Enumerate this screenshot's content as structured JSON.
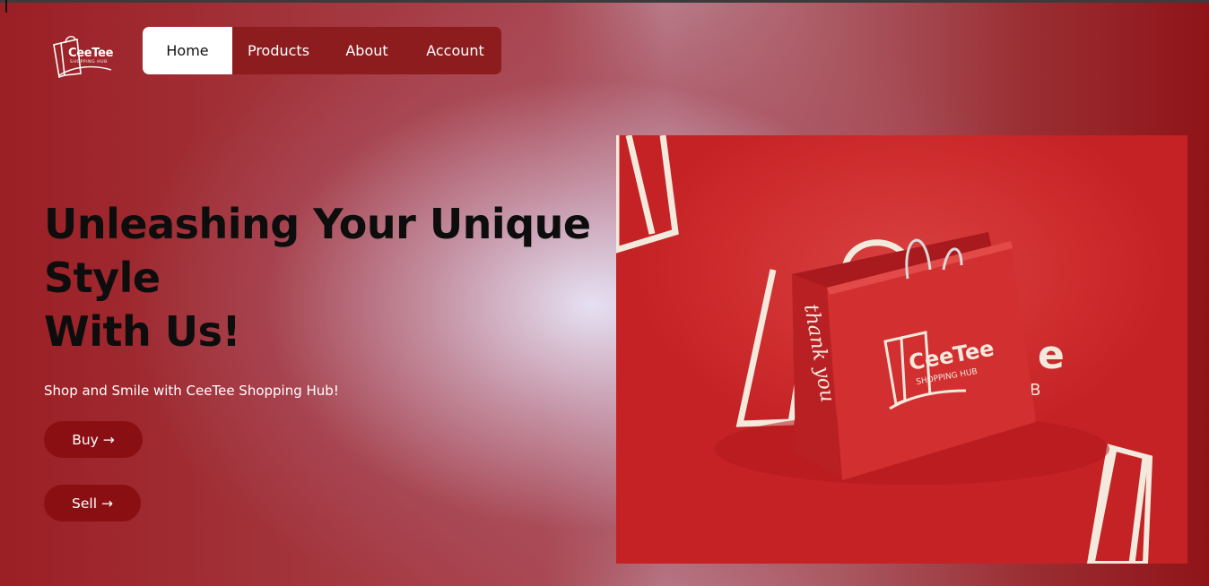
{
  "brand": {
    "name": "CeeTee",
    "tagline": "SHOPPING HUB"
  },
  "nav": {
    "items": [
      {
        "label": "Home",
        "active": true
      },
      {
        "label": "Products",
        "active": false
      },
      {
        "label": "About",
        "active": false
      },
      {
        "label": "Account",
        "active": false
      }
    ]
  },
  "hero": {
    "title_line1": "Unleashing Your Unique",
    "title_line2": "Style",
    "title_line3": "With Us!",
    "subtitle": "Shop and Smile with CeeTee Shopping Hub!",
    "buy_label": "Buy →",
    "sell_label": "Sell →"
  },
  "image": {
    "bag_brand": "CeeTee",
    "bag_tagline": "SHOPPING HUB",
    "bag_side_script": "thank you"
  },
  "colors": {
    "accent": "#8a0f13",
    "nav_bg": "#8d1c1e",
    "image_red": "#cf2e2f"
  }
}
